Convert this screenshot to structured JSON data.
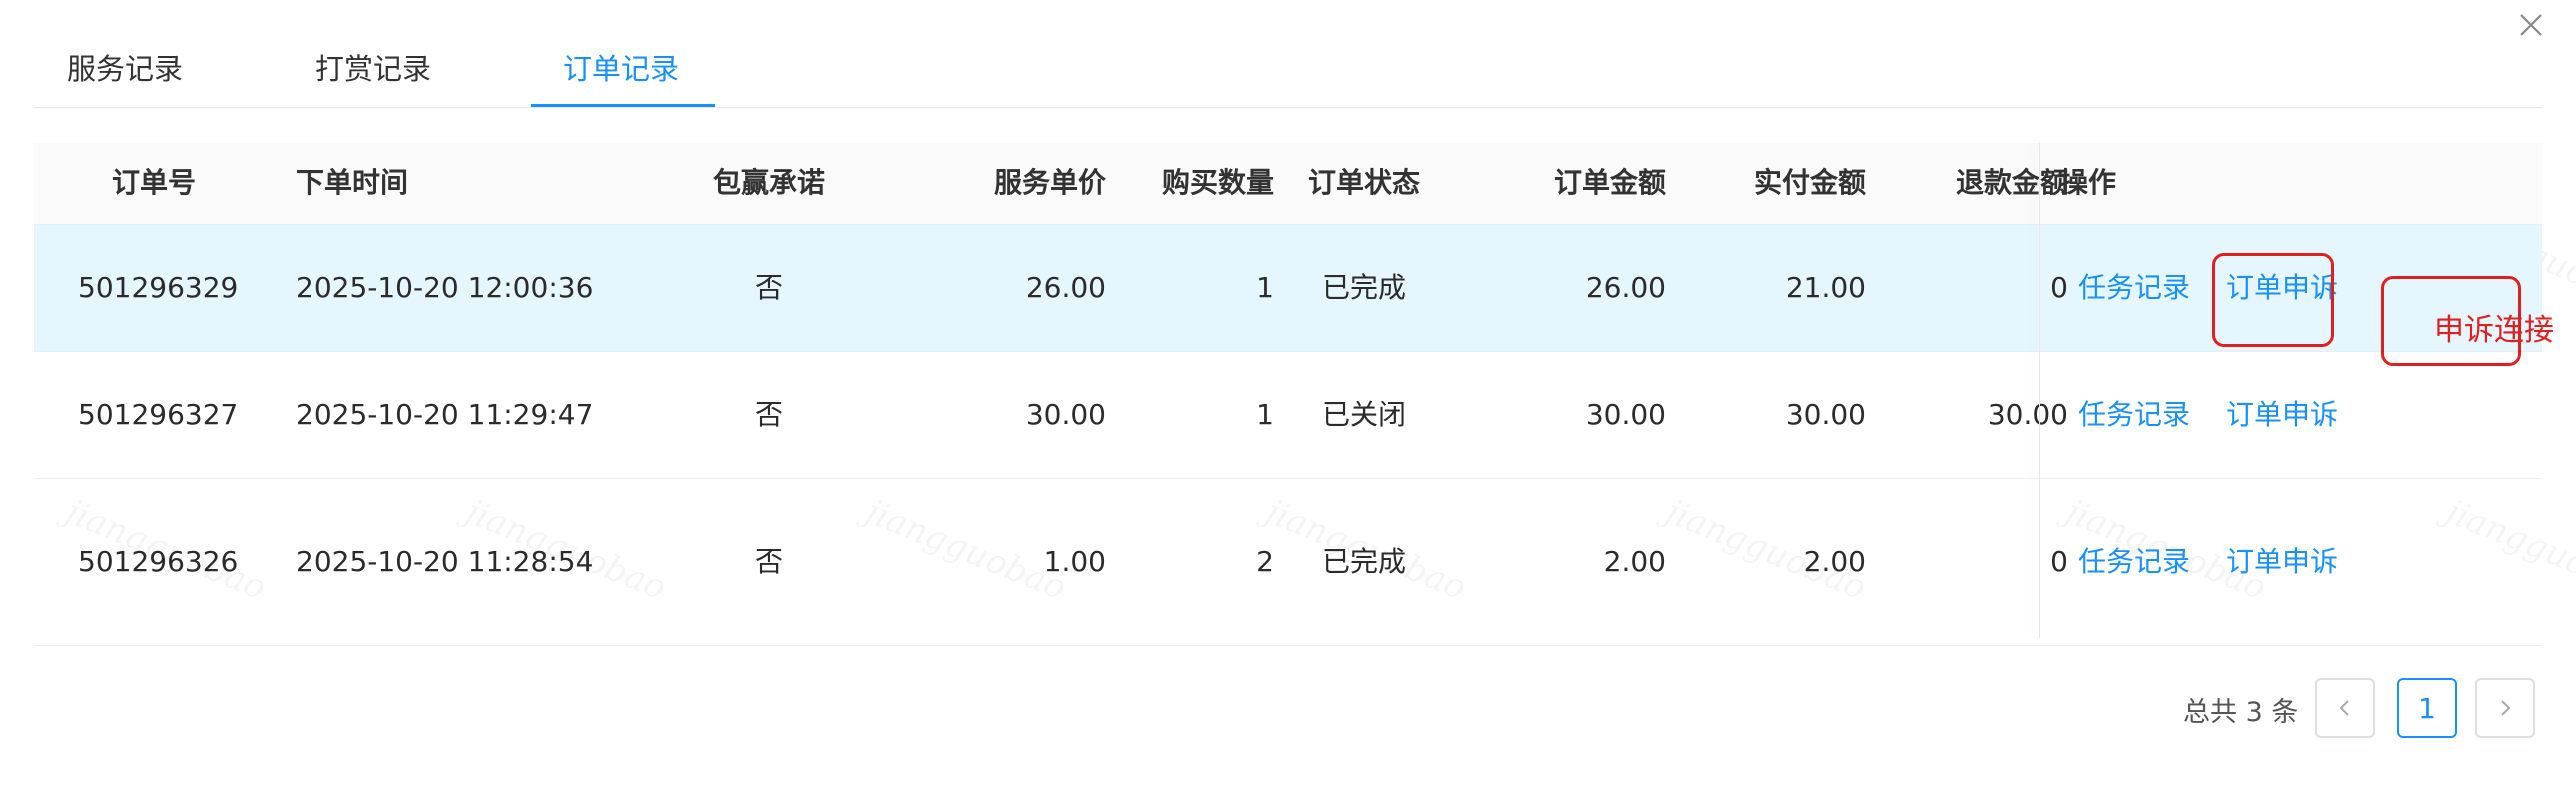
{
  "watermark": "jiangguobao",
  "tabs": [
    {
      "label": "服务记录",
      "active": false
    },
    {
      "label": "打赏记录",
      "active": false
    },
    {
      "label": "订单记录",
      "active": true
    }
  ],
  "table": {
    "headers": [
      "订单号",
      "下单时间",
      "包赢承诺",
      "服务单价",
      "购买数量",
      "订单状态",
      "订单金额",
      "实付金额",
      "退款金额",
      "操作"
    ],
    "rows": [
      {
        "order_no": "501296329",
        "time": "2025-10-20 12:00:36",
        "guarantee": "否",
        "unit_price": "26.00",
        "qty": "1",
        "status": "已完成",
        "amount": "26.00",
        "paid": "21.00",
        "refund": "0",
        "action1": "任务记录",
        "action2": "订单申诉"
      },
      {
        "order_no": "501296327",
        "time": "2025-10-20 11:29:47",
        "guarantee": "否",
        "unit_price": "30.00",
        "qty": "1",
        "status": "已关闭",
        "amount": "30.00",
        "paid": "30.00",
        "refund": "30.00",
        "action1": "任务记录",
        "action2": "订单申诉"
      },
      {
        "order_no": "501296326",
        "time": "2025-10-20 11:28:54",
        "guarantee": "否",
        "unit_price": "1.00",
        "qty": "2",
        "status": "已完成",
        "amount": "2.00",
        "paid": "2.00",
        "refund": "0",
        "action1": "任务记录",
        "action2": "订单申诉"
      }
    ]
  },
  "annotation": {
    "text": "申诉连接",
    "color": "#e02020"
  },
  "pagination": {
    "total_text": "总共 3 条",
    "current_page": "1"
  },
  "colors": {
    "accent": "#1890ff",
    "highlight_row": "#e6f6ff",
    "annotation": "#e02020"
  }
}
